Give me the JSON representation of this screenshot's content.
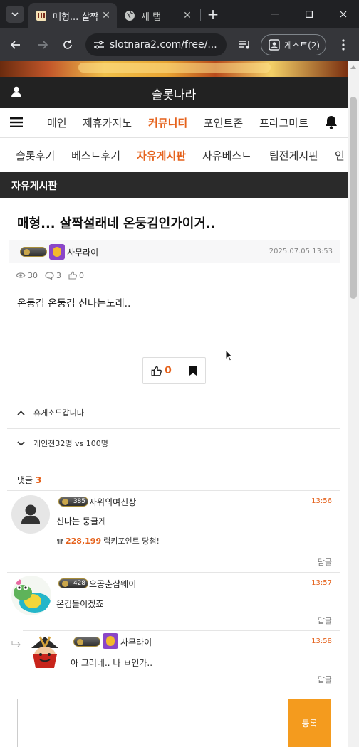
{
  "browser": {
    "active_tab_title": "매형... 살짝",
    "inactive_tab_title": "새 탭",
    "url": "slotnara2.com/free/...",
    "profile_label": "게스트(2)"
  },
  "site": {
    "title": "슬롯나라",
    "main_nav": [
      "메인",
      "제휴카지노",
      "커뮤니티",
      "포인트존",
      "프라그마트"
    ],
    "main_nav_active": "커뮤니티",
    "sub_nav": [
      "슬롯후기",
      "베스트후기",
      "자유게시판",
      "자유베스트",
      "팀전게시판",
      "인"
    ],
    "sub_nav_active": "자유게시판",
    "board_name": "자유게시판"
  },
  "post": {
    "title": "매형... 살짝설래네 온둥김인가이거..",
    "author": "사무라이",
    "date": "2025.07.05 13:53",
    "views": "30",
    "comments": "3",
    "likes": "0",
    "body": "온둥김 온둥김 신나는노래..",
    "vote_count": "0"
  },
  "navigation": {
    "prev_title": "휴게소드갑니다",
    "next_title": "개인전32명 vs 100명"
  },
  "comments_section": {
    "label": "댓글",
    "count": "3",
    "items": [
      {
        "level": "385",
        "name": "자위의여신상",
        "time": "13:56",
        "text": "신나는 둥글게",
        "point_amount": "228,199",
        "point_text": "럭키포인트 당첨!",
        "reply_label": "답글"
      },
      {
        "level": "428",
        "name": "오공춘삼웨이",
        "time": "13:57",
        "text": "온김돌이겠죠",
        "reply_label": "답글"
      },
      {
        "name": "사무라이",
        "time": "13:58",
        "text": "아 그러네.. 나 ㅂ인가..",
        "reply_label": "답글"
      }
    ]
  },
  "comment_form": {
    "submit_label": "등록"
  },
  "colors": {
    "accent": "#e5621c",
    "submit": "#f49b1e",
    "header_bg": "#222222"
  }
}
